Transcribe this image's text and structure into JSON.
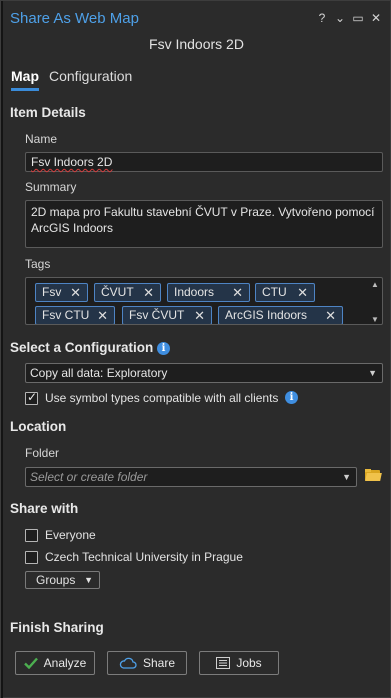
{
  "window": {
    "title": "Share As Web Map",
    "tools": {
      "help": "?",
      "menu": "⌄",
      "restore": "▭",
      "close": "✕"
    },
    "item_name": "Fsv Indoors 2D"
  },
  "tabs": [
    {
      "label": "Map",
      "active": true
    },
    {
      "label": "Configuration",
      "active": false
    }
  ],
  "item_details": {
    "heading": "Item Details",
    "name_label": "Name",
    "name_value": "Fsv Indoors 2D",
    "summary_label": "Summary",
    "summary_value": "2D mapa pro Fakultu stavební ČVUT v Praze. Vytvořeno pomocí ArcGIS Indoors",
    "tags_label": "Tags",
    "tags": [
      "Fsv",
      "ČVUT",
      "Indoors",
      "CTU",
      "Fsv CTU",
      "Fsv ČVUT",
      "ArcGIS Indoors"
    ]
  },
  "configuration": {
    "heading": "Select a Configuration",
    "selected": "Copy all data: Exploratory",
    "symbol_types_label": "Use symbol types compatible with all clients",
    "symbol_types_checked": true
  },
  "location": {
    "heading": "Location",
    "folder_label": "Folder",
    "folder_placeholder": "Select or create folder"
  },
  "share_with": {
    "heading": "Share with",
    "everyone_label": "Everyone",
    "everyone_checked": false,
    "org_label": "Czech Technical University in Prague",
    "org_checked": false,
    "groups_label": "Groups"
  },
  "finish": {
    "heading": "Finish Sharing",
    "analyze_label": "Analyze",
    "share_label": "Share",
    "jobs_label": "Jobs"
  },
  "colors": {
    "accent": "#3a8bd9",
    "title": "#4ea0e8",
    "background": "#2b2b2b",
    "input_bg": "#1e1e1e",
    "analyze_check": "#4caf50",
    "folder": "#e9b93a"
  }
}
